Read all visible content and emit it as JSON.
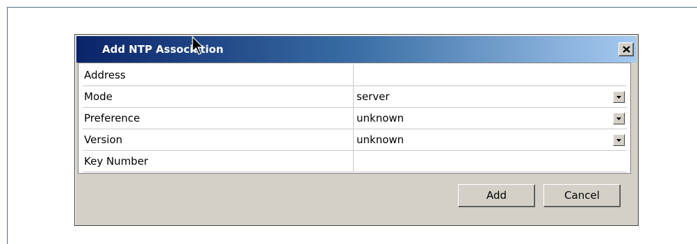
{
  "dialog": {
    "title": "Add NTP Association",
    "close_icon": "close-icon"
  },
  "fields": [
    {
      "label": "Address",
      "value": "",
      "type": "text"
    },
    {
      "label": "Mode",
      "value": "server",
      "type": "dropdown"
    },
    {
      "label": "Preference",
      "value": "unknown",
      "type": "dropdown"
    },
    {
      "label": "Version",
      "value": "unknown",
      "type": "dropdown"
    },
    {
      "label": "Key Number",
      "value": "",
      "type": "text"
    }
  ],
  "buttons": {
    "add_label": "Add",
    "cancel_label": "Cancel"
  },
  "colors": {
    "titlebar_start": "#0a246a",
    "titlebar_end": "#a6caf0",
    "dialog_bg": "#d4d0c8"
  }
}
